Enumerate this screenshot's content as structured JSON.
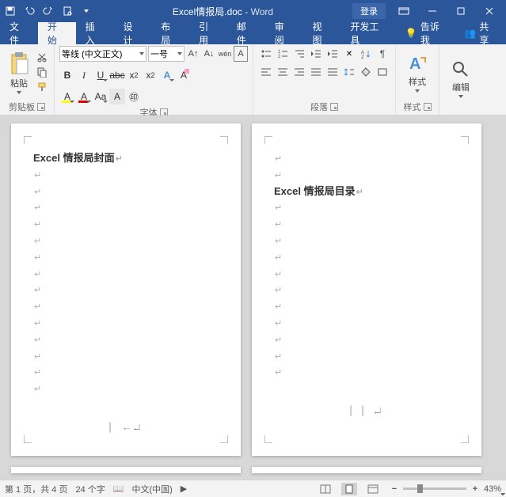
{
  "title": {
    "filename": "Excel情报局.doc",
    "app": "Word",
    "login": "登录"
  },
  "tabs": {
    "file": "文件",
    "home": "开始",
    "insert": "插入",
    "design": "设计",
    "layout": "布局",
    "references": "引用",
    "mailings": "邮件",
    "review": "审阅",
    "view": "视图",
    "developer": "开发工具",
    "tell": "告诉我",
    "share": "共享"
  },
  "ribbon": {
    "clipboard": {
      "paste": "粘贴",
      "label": "剪贴板"
    },
    "font": {
      "name": "等线 (中文正文)",
      "size": "一号",
      "label": "字体",
      "wen": "wén",
      "A": "A"
    },
    "paragraph": {
      "label": "段落"
    },
    "styles": {
      "btn": "样式",
      "label": "样式"
    },
    "editing": {
      "btn": "编辑"
    }
  },
  "doc": {
    "page1_title": "Excel 情报局封面",
    "page2_title": "Excel 情报局目录",
    "page2_blank_lines": 2
  },
  "status": {
    "page": "第 1 页，共 4 页",
    "words": "24 个字",
    "lang": "中文(中国)",
    "zoom": "43%"
  }
}
